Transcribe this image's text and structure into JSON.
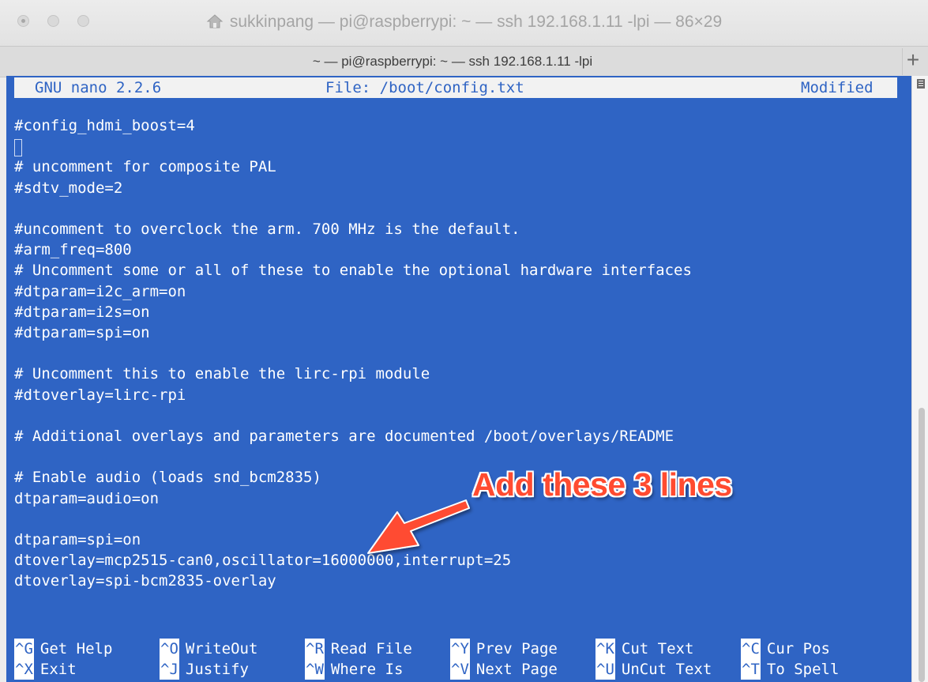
{
  "window": {
    "title": "sukkinpang — pi@raspberrypi: ~ — ssh 192.168.1.11 -lpi — 86×29",
    "tab_title": "~ — pi@raspberrypi: ~ — ssh 192.168.1.11 -lpi",
    "new_tab_label": "+"
  },
  "nano": {
    "version": "GNU nano 2.2.6",
    "file": "File: /boot/config.txt",
    "status": "Modified"
  },
  "lines": [
    "#config_hdmi_boost=4",
    "",
    "# uncomment for composite PAL",
    "#sdtv_mode=2",
    "",
    "#uncomment to overclock the arm. 700 MHz is the default.",
    "#arm_freq=800",
    "# Uncomment some or all of these to enable the optional hardware interfaces",
    "#dtparam=i2c_arm=on",
    "#dtparam=i2s=on",
    "#dtparam=spi=on",
    "",
    "# Uncomment this to enable the lirc-rpi module",
    "#dtoverlay=lirc-rpi",
    "",
    "# Additional overlays and parameters are documented /boot/overlays/README",
    "",
    "# Enable audio (loads snd_bcm2835)",
    "dtparam=audio=on",
    "",
    "dtparam=spi=on",
    "dtoverlay=mcp2515-can0,oscillator=16000000,interrupt=25",
    "dtoverlay=spi-bcm2835-overlay"
  ],
  "shortcuts": [
    {
      "key": "^G",
      "label": "Get Help"
    },
    {
      "key": "^O",
      "label": "WriteOut"
    },
    {
      "key": "^R",
      "label": "Read File"
    },
    {
      "key": "^Y",
      "label": "Prev Page"
    },
    {
      "key": "^K",
      "label": "Cut Text"
    },
    {
      "key": "^C",
      "label": "Cur Pos"
    },
    {
      "key": "^X",
      "label": "Exit"
    },
    {
      "key": "^J",
      "label": "Justify"
    },
    {
      "key": "^W",
      "label": "Where Is"
    },
    {
      "key": "^V",
      "label": "Next Page"
    },
    {
      "key": "^U",
      "label": "UnCut Text"
    },
    {
      "key": "^T",
      "label": "To Spell"
    }
  ],
  "annotation": {
    "text": "Add these 3 lines",
    "color": "#ff4b30"
  },
  "colors": {
    "terminal_bg": "#2f64c4",
    "terminal_fg": "#ffffff"
  }
}
